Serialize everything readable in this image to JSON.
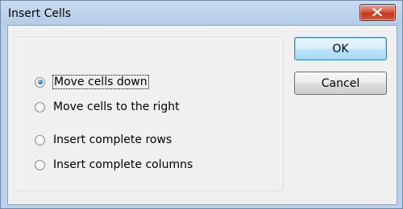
{
  "window": {
    "title": "Insert Cells"
  },
  "options": [
    {
      "label": "Move cells down",
      "checked": true
    },
    {
      "label": "Move cells to the right",
      "checked": false
    },
    {
      "label": "Insert complete rows",
      "checked": false
    },
    {
      "label": "Insert complete columns",
      "checked": false
    }
  ],
  "buttons": {
    "ok_label": "OK",
    "cancel_label": "Cancel"
  },
  "icons": {
    "close": "close-icon",
    "radio_selected": "radio-selected-icon"
  },
  "colors": {
    "titlebar": "#bcd3ea",
    "close_button": "#c3371d",
    "dialog_bg": "#f0f0f0"
  }
}
